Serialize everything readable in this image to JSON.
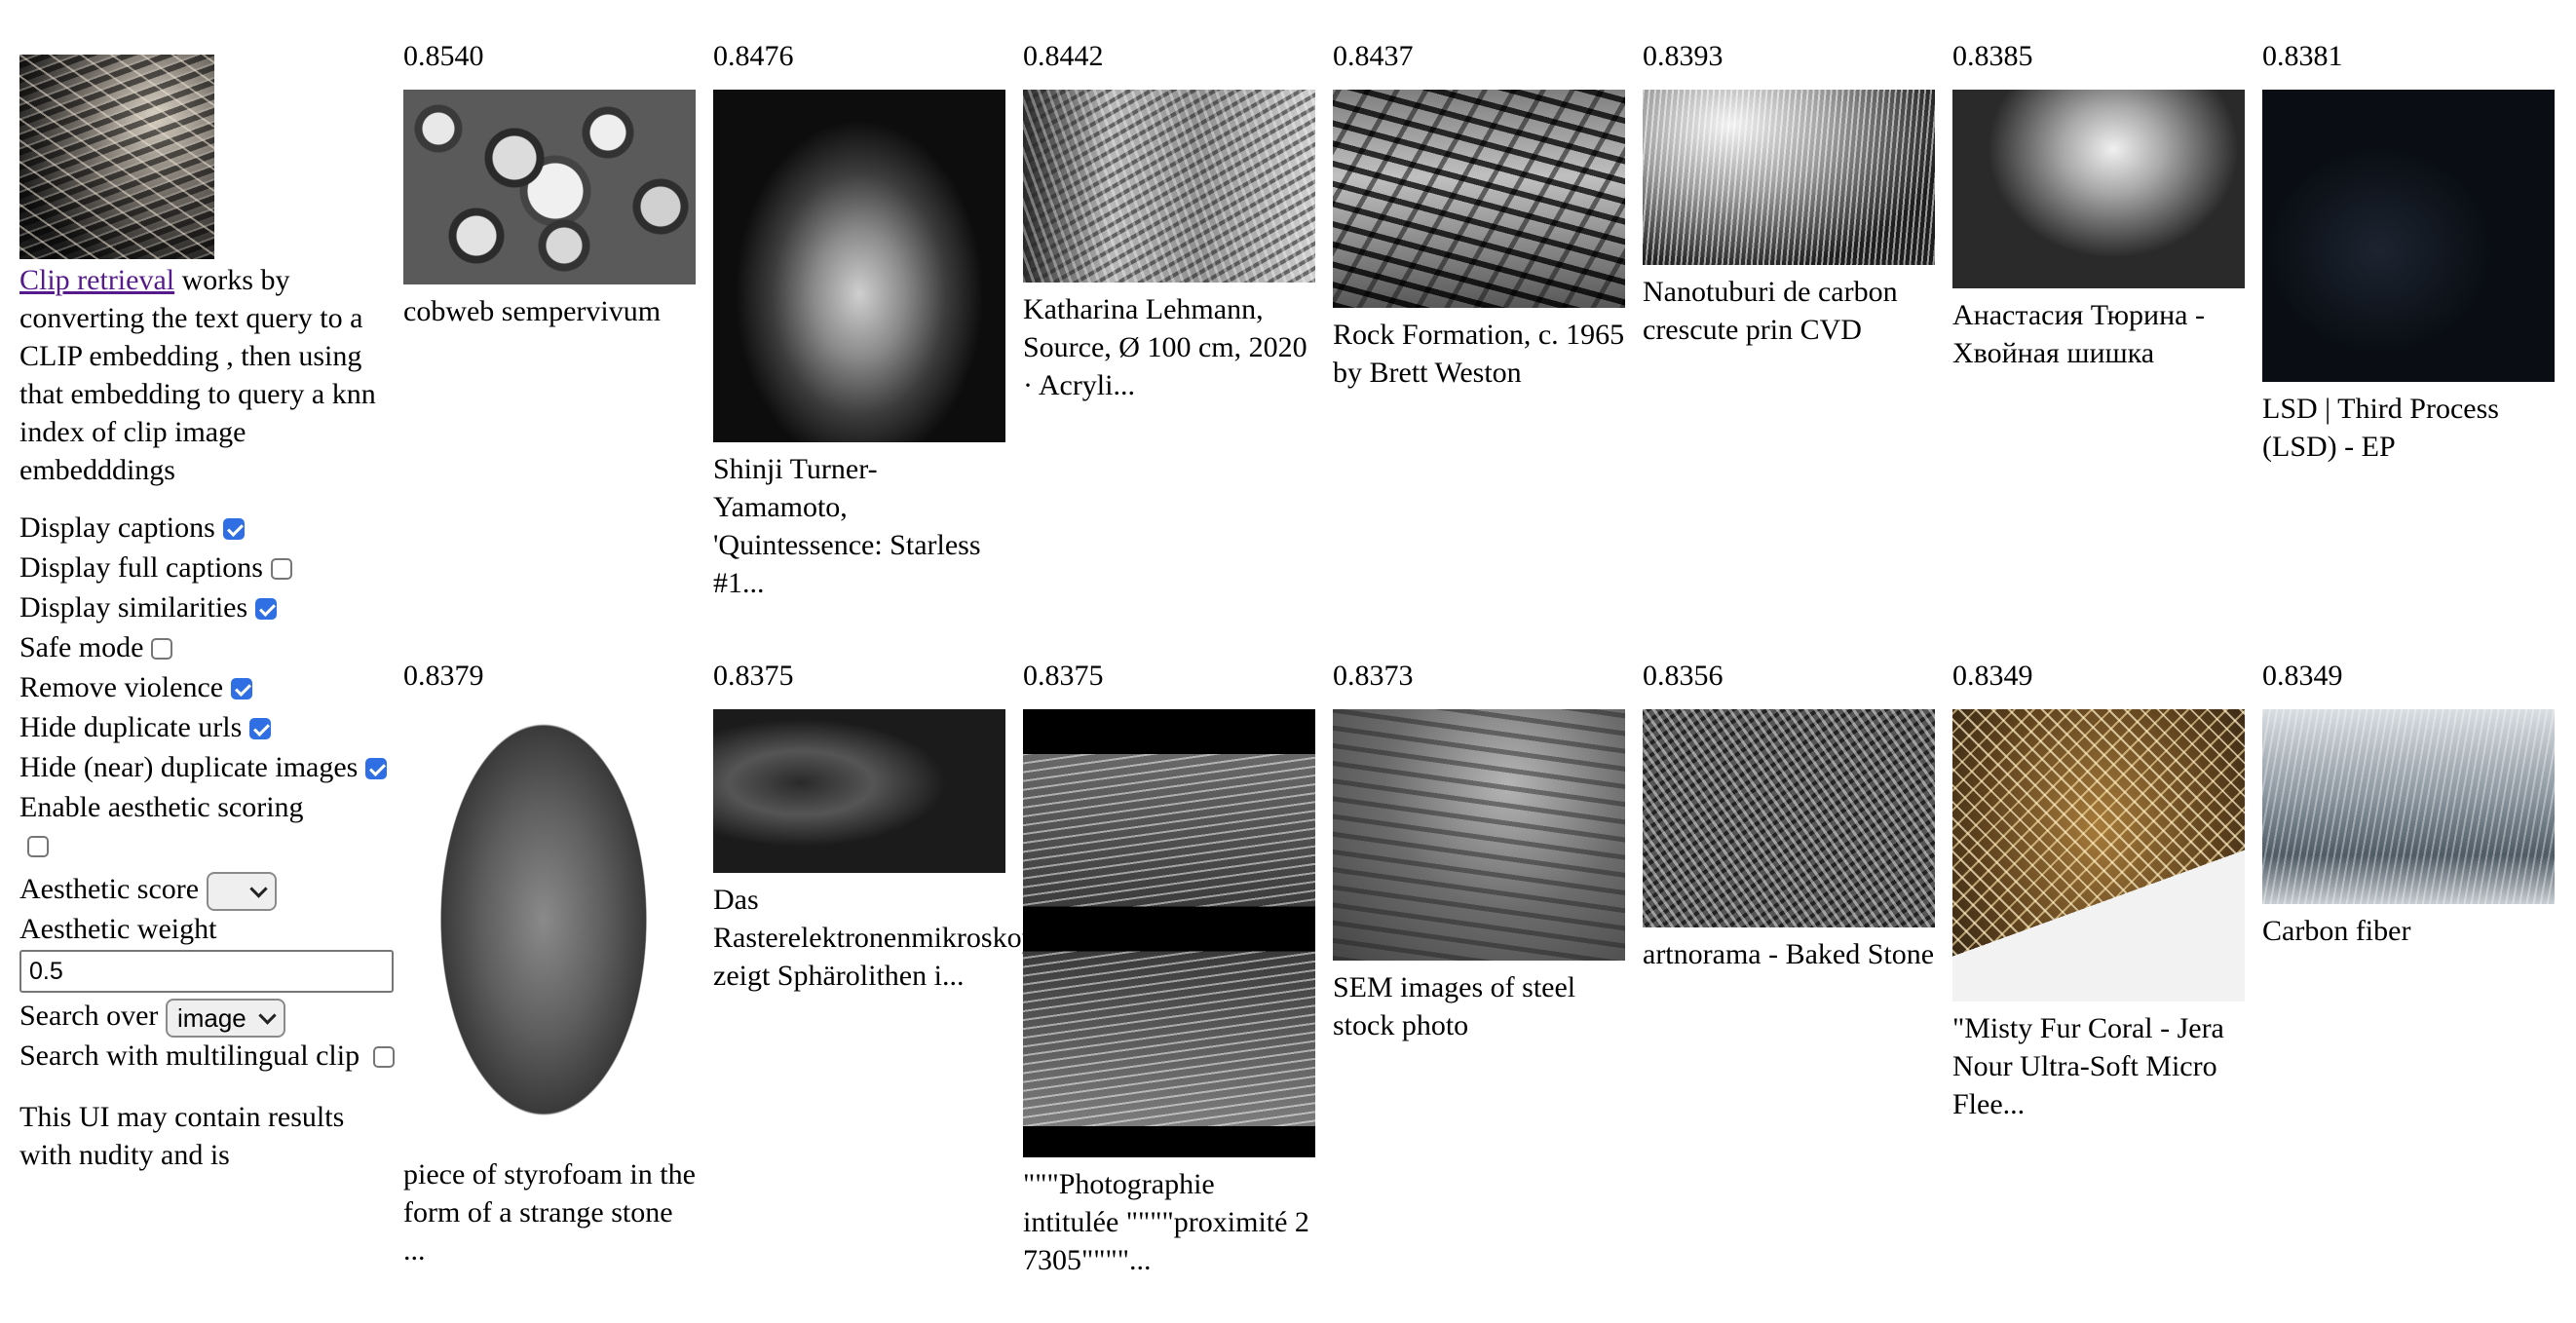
{
  "sidebar": {
    "query_image_alt": "query image",
    "link_text": "Clip retrieval",
    "description": " works by converting the text query to a CLIP embedding , then using that embedding to query a knn index of clip image embedddings",
    "options": {
      "display_captions": {
        "label": "Display captions",
        "checked": true
      },
      "display_full_captions": {
        "label": "Display full captions",
        "checked": false
      },
      "display_similarities": {
        "label": "Display similarities",
        "checked": true
      },
      "safe_mode": {
        "label": "Safe mode",
        "checked": false
      },
      "remove_violence": {
        "label": "Remove violence",
        "checked": true
      },
      "hide_duplicate_urls": {
        "label": "Hide duplicate urls",
        "checked": true
      },
      "hide_near_duplicate_images": {
        "label": "Hide (near) duplicate images",
        "checked": true
      },
      "enable_aesthetic_scoring": {
        "label": "Enable aesthetic scoring",
        "checked": false
      }
    },
    "aesthetic_score": {
      "label": "Aesthetic score",
      "value": ""
    },
    "aesthetic_weight": {
      "label": "Aesthetic weight",
      "value": "0.5"
    },
    "search_over": {
      "label": "Search over",
      "value": "image"
    },
    "multilingual": {
      "label": "Search with multilingual clip",
      "checked": false
    },
    "notice": "This UI may contain results with nudity and is"
  },
  "results": [
    {
      "similarity": "0.8540",
      "caption": "cobweb sempervivum",
      "texture": "cobweb"
    },
    {
      "similarity": "0.8476",
      "caption": "Shinji Turner-Yamamoto, 'Quintessence: Starless #1...",
      "texture": "shinji"
    },
    {
      "similarity": "0.8442",
      "caption": "Katharina Lehmann, Source, Ø 100 cm, 2020 · Acryli...",
      "texture": "kath"
    },
    {
      "similarity": "0.8437",
      "caption": "Rock Formation, c. 1965 by Brett Weston",
      "texture": "rock"
    },
    {
      "similarity": "0.8393",
      "caption": "Nanotuburi de carbon crescute prin CVD",
      "texture": "nano"
    },
    {
      "similarity": "0.8385",
      "caption": "Анастасия Тюрина - Хвойная шишка",
      "texture": "pine"
    },
    {
      "similarity": "0.8381",
      "caption": "LSD | Third Process (LSD) - EP",
      "texture": "lsd"
    },
    {
      "similarity": "0.8379",
      "caption": "piece of styrofoam in the form of a strange stone ...",
      "texture": "styro"
    },
    {
      "similarity": "0.8375",
      "caption": "Das Rasterelektronenmikroskop zeigt Sphärolithen i...",
      "texture": "das"
    },
    {
      "similarity": "0.8375",
      "caption": "\"\"\"Photographie intitulée \"\"\"\"proximité 2 7305\"\"\"\"...",
      "texture": "photo"
    },
    {
      "similarity": "0.8373",
      "caption": "SEM images of steel stock photo",
      "texture": "steel"
    },
    {
      "similarity": "0.8356",
      "caption": "artnorama - Baked Stone",
      "texture": "stone"
    },
    {
      "similarity": "0.8349",
      "caption": "\"Misty Fur Coral - Jera Nour Ultra-Soft Micro Flee...",
      "texture": "coral"
    },
    {
      "similarity": "0.8349",
      "caption": "Carbon fiber",
      "texture": "carbon"
    }
  ]
}
